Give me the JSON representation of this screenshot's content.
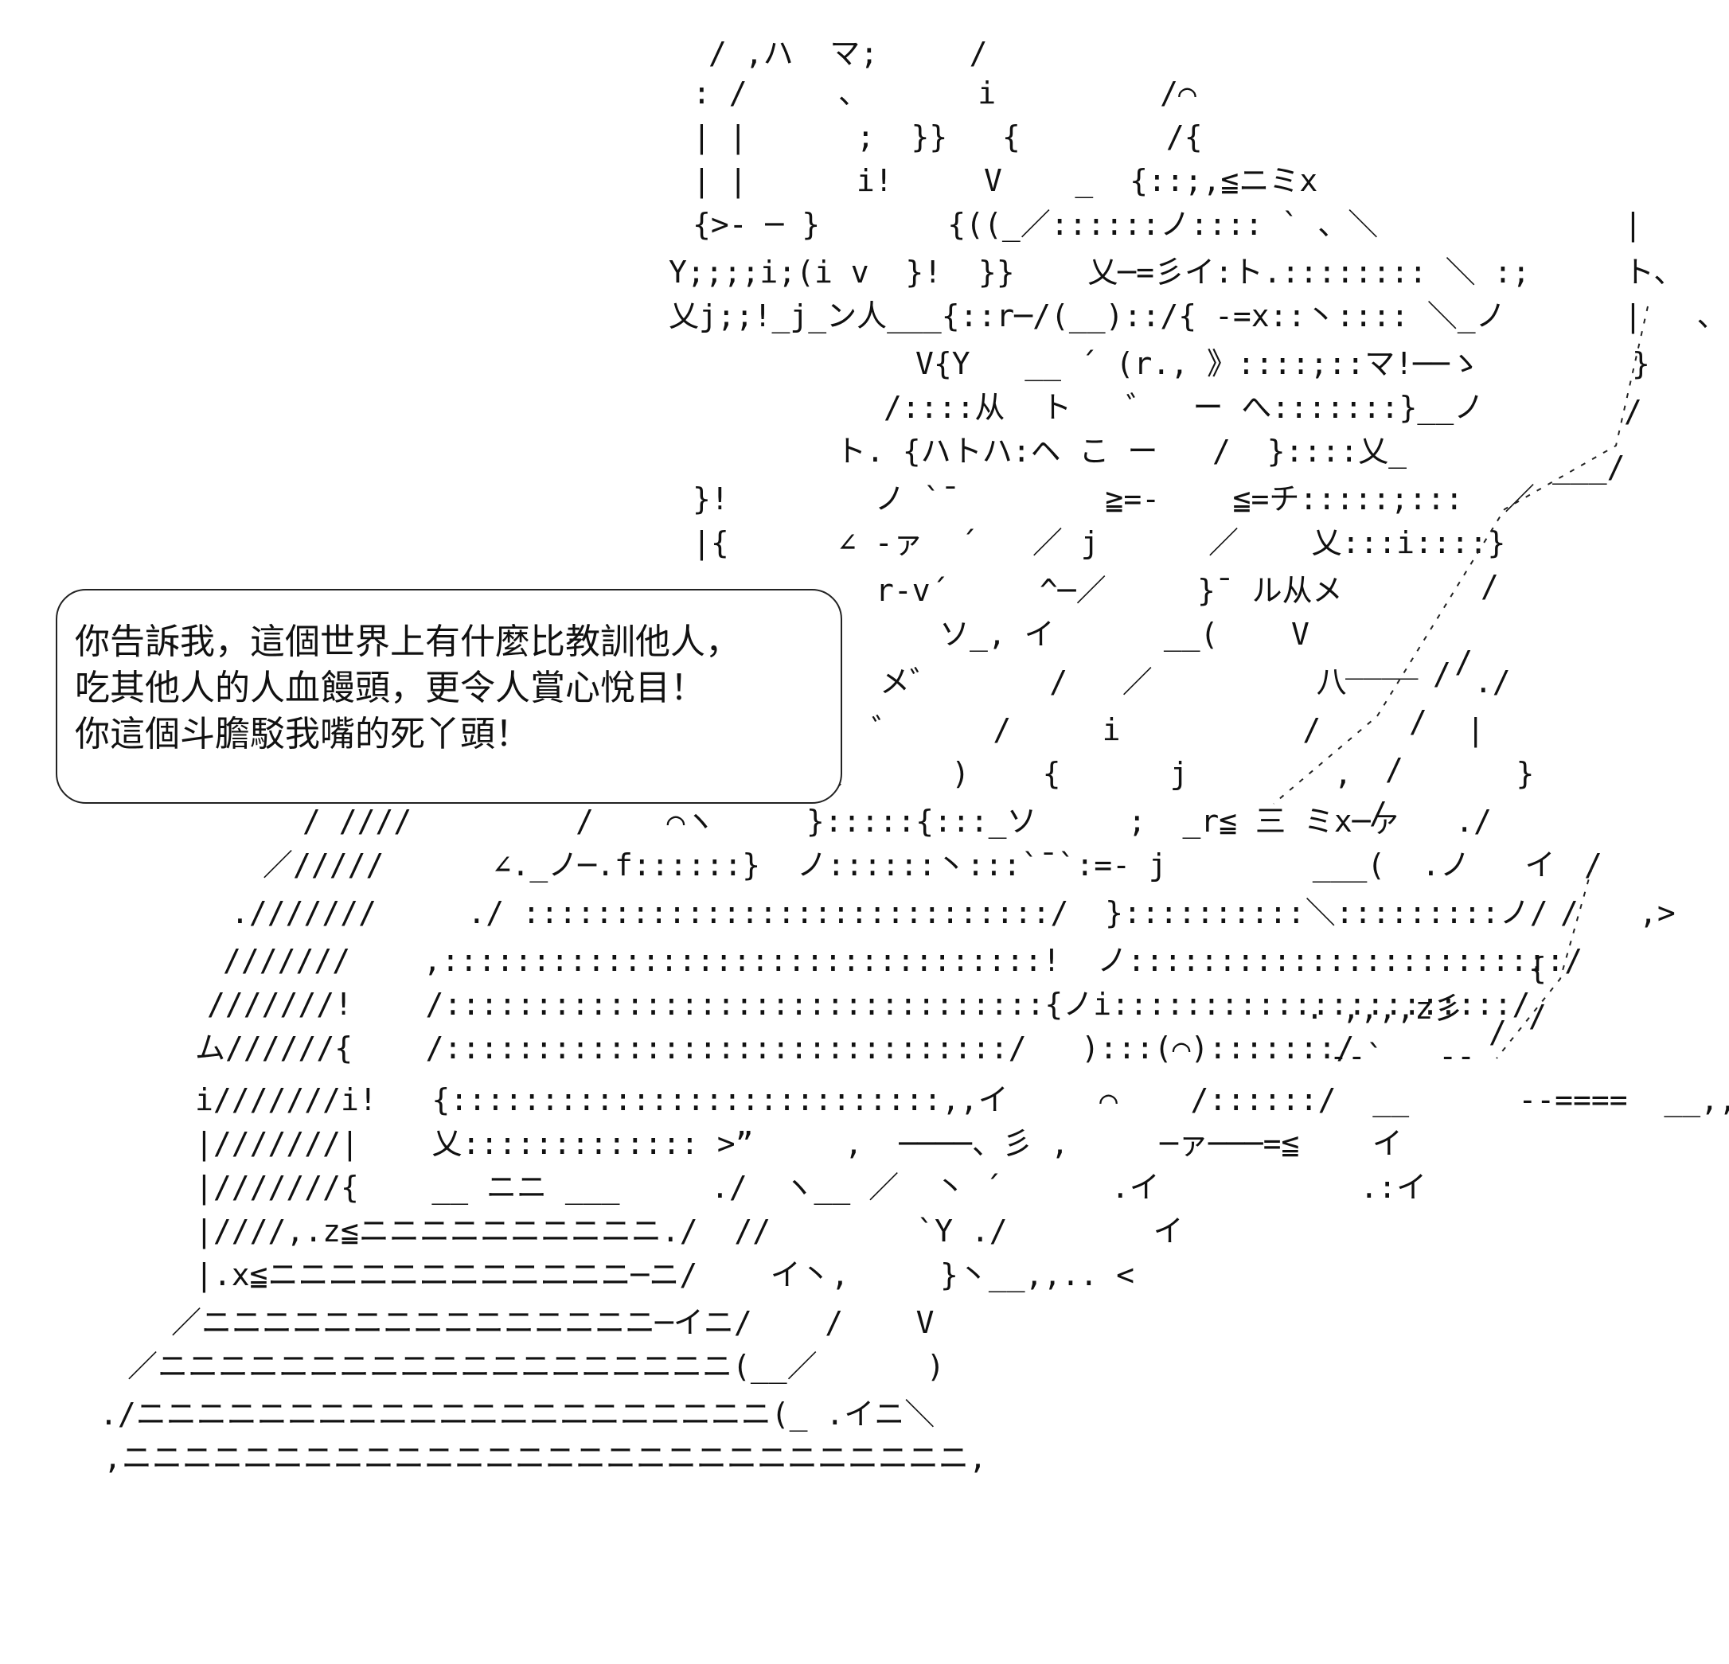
{
  "speech_bubble": {
    "lines": [
      "你告訴我，這個世界上有什麼比教訓他人，",
      "吃其他人的人血饅頭，更令人賞心悅目！",
      "你這個斗膽駁我嘴的死丫頭！"
    ]
  },
  "art_lines": [
    "/ ,ハ  マ;     /",
    ": /     、      i         /⌒",
    "| |      ;  }}   {        /{",
    "| |      i!     V    _  {::;,≦ニミx",
    "{>- ─ }       {((_／::::::ノ:::: ` 、＼",
    "Y;;;;i;(i v  }!  }}    乂─=彡イ:ト.:::::::: ＼ :;",
    "乂j;;!_j_ン人___{::r─/(__)::/{ -=x::丶:::: ＼_ノ",
    "V{Y   __ ´ (r., 》::::;::マ!──ゝ",
    "/::::从  ト   ゛  ー へ:::::::}__ノ",
    "ト. {ハトハ:ヘ こ ー   /  }::::乂_",
    "}!        ノ `¯        ≧=-    ≦=チ:::::;:::",
    "|{      ∠ -ァ  ´   ／ j      ／    乂:::i::::}",
    "r-v´     ^─／     }¯ ル从メ",
    "ソ_, イ      __(    V",
    "メ゛      /   ／         八       ./",
    "゛     /     i          /        |",
    "乂      )    {      j        ,         }",
    "/ ////         /    ⌒ヽ     }:::::{:::_ソ     ;  _r≦ 三 ミx─ァ   ./",
    "／/////      ∠._ノ─.f::::::}  ノ::::::丶:::`¯`:=- j        ___(  .ノ   イ",
    ".///////     ./ :::::::::::::::::::::::::::::/  }::::::::::＼:::::::::ノ/     ,>",
    "///////    ,:::::::::::::::::::::::::::::::::!  ノ::::::::::::::::::::::::/",
    "///////!    /:::::::::::::::::::::::::::::::::{ノi::::::::::::::::::::::/",
    "ム//////{    /:::::::::::::::::::::::::::::::/   ):::(⌒):::::::/",
    "i///////i!   {:::::::::::::::::::::::::::,,イ     ⌒    /::::::/  __      --====  __,,z≦ア",
    "|///////|    乂::::::::::::: >”     ,  ────、彡 ,     ─ァ───=≦    イ",
    "|///////{    __ ニニ ___     ./  ヽ__ ／  丶 ´      .イ           .:イ",
    "|////,.z≦ニニニニニニニニニニ./  //        `Y ./        イ",
    "|.x≦ニニニニニニニニニニニニ─ニ/    イ丶,     }丶__,,.. <",
    "／ニニニニニニニニニニニニニニニ─イニ/    /    V",
    "／ニニニニニニニニニニニニニニニニニニニ(__／      )",
    "./ニニニニニニニニニニニニニニニニニニニニニ(_ .イニ＼",
    ",ニニニニニニニニニニニニニニニニニニニニニニニニニニニニ,",
    "|",
    "ト、",
    "|   、",
    "}",
    "/",
    "___/",
    "／",
    "/",
    "____  /",
    "/",
    "/",
    "/",
    "/",
    "/",
    "/",
    "{",
    "/",
    ". ,,,,z彡",
    "--`   --",
    "/"
  ]
}
